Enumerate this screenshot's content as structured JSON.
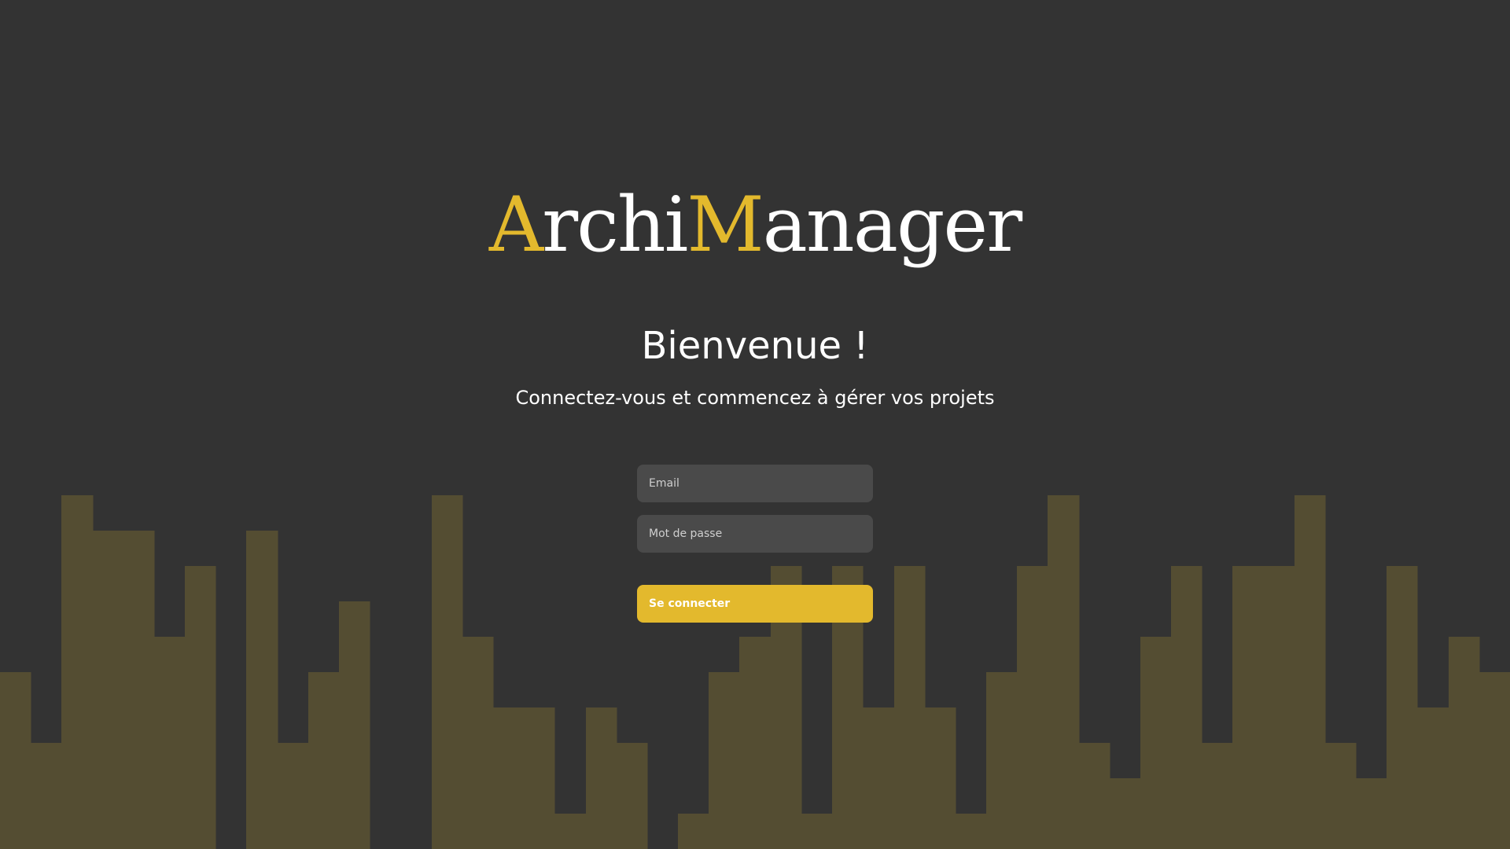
{
  "colors": {
    "background": "#333333",
    "accent": "#e3b92d",
    "skyline": "#544d32",
    "input_background": "#4a4a4a",
    "text": "#ffffff"
  },
  "logo": {
    "part1_accent": "A",
    "part2": "rchi",
    "part3_accent": "M",
    "part4": "anager"
  },
  "welcome": {
    "title": "Bienvenue !",
    "subtitle": "Connectez-vous et commencez à gérer vos projets"
  },
  "form": {
    "email_placeholder": "Email",
    "password_placeholder": "Mot de passe",
    "submit_label": "Se connecter"
  }
}
